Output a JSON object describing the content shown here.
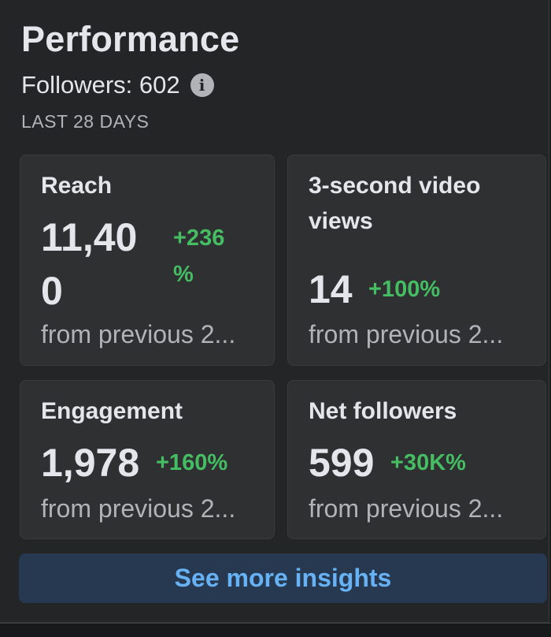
{
  "header": {
    "title": "Performance",
    "followers_label": "Followers: 602",
    "info_icon": "info-icon",
    "period": "LAST 28 DAYS"
  },
  "cards": {
    "reach": {
      "label": "Reach",
      "value_line1": "11,40",
      "value_line2": "0",
      "change_line1": "+236",
      "change_line2": "%",
      "sub": "from previous 2..."
    },
    "video_views": {
      "label_line1": "3-second video",
      "label_line2": "views",
      "value": "14",
      "change": "+100%",
      "sub": "from previous 2..."
    },
    "engagement": {
      "label": "Engagement",
      "value": "1,978",
      "change": "+160%",
      "sub": "from previous 2..."
    },
    "net_followers": {
      "label": "Net followers",
      "value": "599",
      "change": "+30K%",
      "sub": "from previous 2..."
    }
  },
  "cta": {
    "label": "See more insights"
  },
  "colors": {
    "background": "#242527",
    "card": "#2f3032",
    "positive": "#45bd62",
    "link": "#66b2f5",
    "button": "#263951"
  }
}
